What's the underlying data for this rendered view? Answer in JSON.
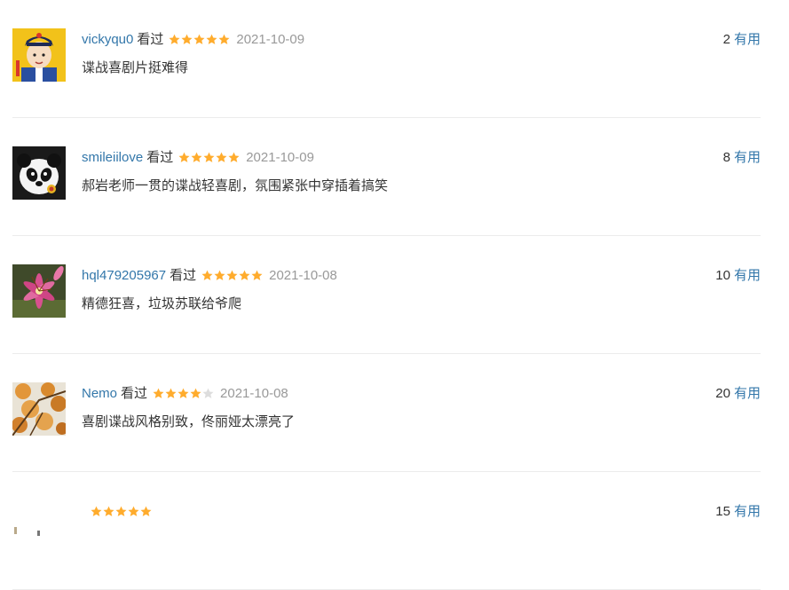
{
  "colors": {
    "link": "#3377aa",
    "text": "#333333",
    "date": "#999999",
    "star": "#ffac2d",
    "star_empty": "#dddddd"
  },
  "reviews": [
    {
      "username": "vickyqu0",
      "status": "看过",
      "rating": 5,
      "date": "2021-10-09",
      "useful_count": "2",
      "useful_label": "有用",
      "comment": "谍战喜剧片挺难得",
      "avatar": "cartoon-boy-avatar"
    },
    {
      "username": "smileiilove",
      "status": "看过",
      "rating": 5,
      "date": "2021-10-09",
      "useful_count": "8",
      "useful_label": "有用",
      "comment": "郝岩老师一贯的谍战轻喜剧，氛围紧张中穿插着搞笑",
      "avatar": "panda-avatar"
    },
    {
      "username": "hql479205967",
      "status": "看过",
      "rating": 5,
      "date": "2021-10-08",
      "useful_count": "10",
      "useful_label": "有用",
      "comment": "精德狂喜，垃圾苏联给爷爬",
      "avatar": "lily-flower-avatar"
    },
    {
      "username": "Nemo",
      "status": "看过",
      "rating": 4,
      "date": "2021-10-08",
      "useful_count": "20",
      "useful_label": "有用",
      "comment": "喜剧谍战风格别致，佟丽娅太漂亮了",
      "avatar": "autumn-leaves-avatar"
    },
    {
      "username": "",
      "status": "",
      "rating": 5,
      "date": "",
      "useful_count": "15",
      "useful_label": "有用",
      "comment": "",
      "avatar": "partial-avatar"
    }
  ]
}
